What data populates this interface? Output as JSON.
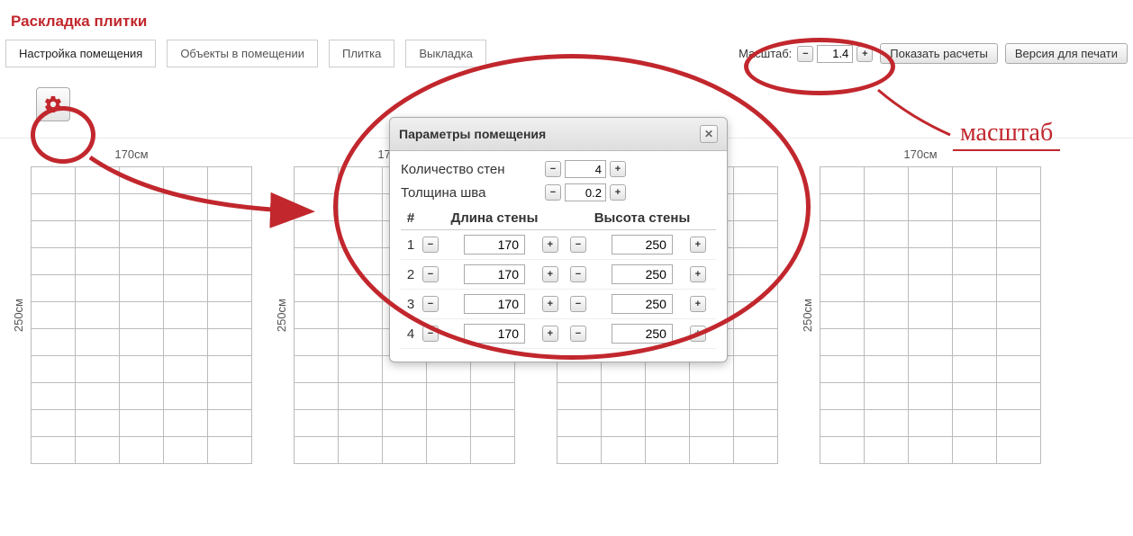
{
  "title": "Раскладка плитки",
  "tabs": [
    {
      "label": "Настройка помещения",
      "active": true
    },
    {
      "label": "Объекты в помещении",
      "active": false
    },
    {
      "label": "Плитка",
      "active": false
    },
    {
      "label": "Выкладка",
      "active": false
    }
  ],
  "scale": {
    "label": "Масштаб:",
    "value": "1.4"
  },
  "buttons": {
    "show_calc": "Показать расчеты",
    "print": "Версия для печати"
  },
  "annotation_label": "масштаб",
  "dialog": {
    "title": "Параметры помещения",
    "wall_count_label": "Количество стен",
    "wall_count": "4",
    "seam_label": "Толщина шва",
    "seam": "0.2",
    "headers": {
      "num": "#",
      "length": "Длина стены",
      "height": "Высота стены"
    },
    "rows": [
      {
        "n": "1",
        "length": "170",
        "height": "250"
      },
      {
        "n": "2",
        "length": "170",
        "height": "250"
      },
      {
        "n": "3",
        "length": "170",
        "height": "250"
      },
      {
        "n": "4",
        "length": "170",
        "height": "250"
      }
    ]
  },
  "wall_labels": {
    "top": "170см",
    "side": "250см"
  }
}
